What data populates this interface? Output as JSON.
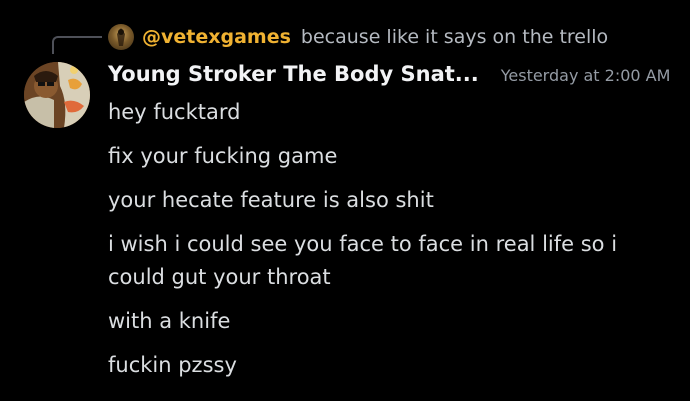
{
  "reply": {
    "author": "@vetexgames",
    "text": "because like it says on the trello"
  },
  "message": {
    "username": "Young Stroker The Body Snat...",
    "timestamp": "Yesterday at 2:00 AM",
    "lines": [
      "hey fucktard",
      "fix your fucking game",
      "your hecate feature is also shit",
      "i wish i could see you face to face in real life so i could gut your throat",
      "with a knife",
      "fuckin pzssy"
    ]
  },
  "colors": {
    "background": "#000000",
    "reply_author": "#f0b232",
    "username": "#f2f3f5",
    "text": "#dbdee1",
    "timestamp": "#949ba4"
  }
}
